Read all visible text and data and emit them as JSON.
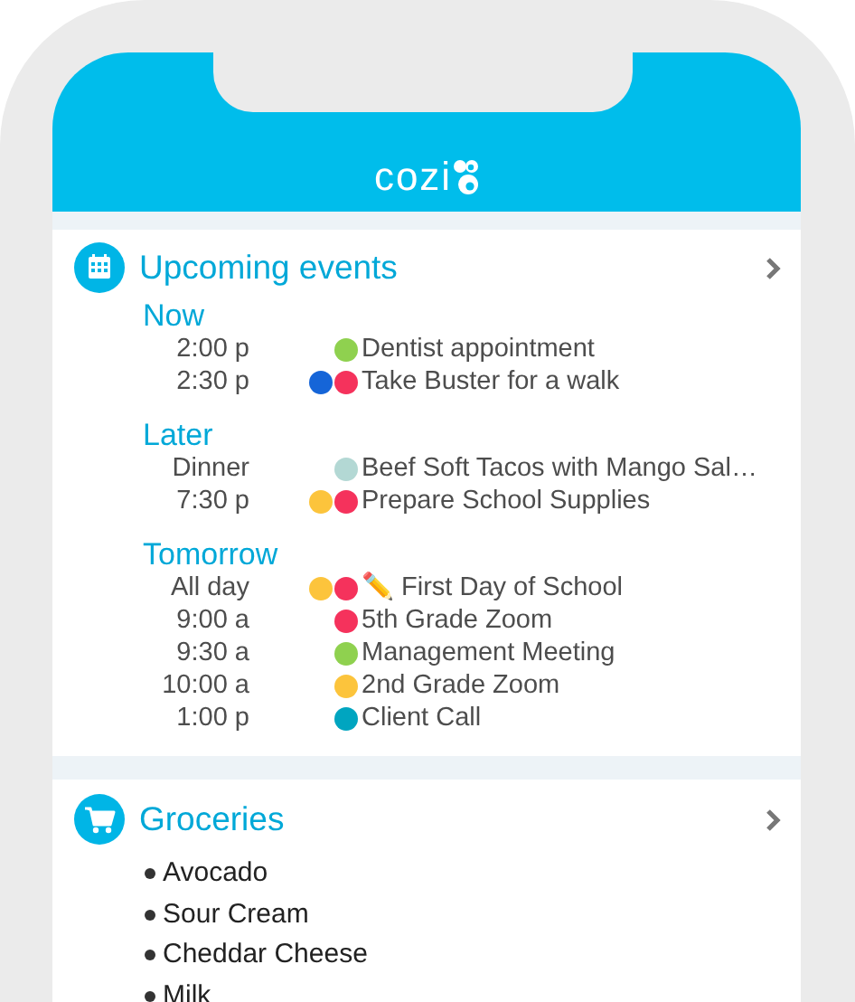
{
  "header": {
    "logo": "cozi"
  },
  "upcoming_events": {
    "title": "Upcoming events",
    "groups": [
      {
        "label": "Now",
        "items": [
          {
            "time": "2:00 p",
            "dots": [
              {
                "color": "#8fd14f"
              }
            ],
            "title": "Dentist appointment"
          },
          {
            "time": "2:30 p",
            "dots": [
              {
                "color": "#1565d8"
              },
              {
                "color": "#f5325c"
              }
            ],
            "title": "Take Buster for a walk"
          }
        ]
      },
      {
        "label": "Later",
        "items": [
          {
            "time": "Dinner",
            "dots": [
              {
                "color": "#b3d8d4"
              }
            ],
            "title": "Beef Soft Tacos with Mango Sal…"
          },
          {
            "time": "7:30 p",
            "dots": [
              {
                "color": "#fcc43c"
              },
              {
                "color": "#f5325c"
              }
            ],
            "title": "Prepare School Supplies"
          }
        ]
      },
      {
        "label": "Tomorrow",
        "items": [
          {
            "time": "All day",
            "dots": [
              {
                "color": "#fcc43c"
              },
              {
                "color": "#f5325c"
              }
            ],
            "title": "✏️ First Day of School"
          },
          {
            "time": "9:00 a",
            "dots": [
              {
                "color": "#f5325c"
              }
            ],
            "title": "5th Grade Zoom"
          },
          {
            "time": "9:30 a",
            "dots": [
              {
                "color": "#8fd14f"
              }
            ],
            "title": "Management Meeting"
          },
          {
            "time": "10:00 a",
            "dots": [
              {
                "color": "#fcc43c"
              }
            ],
            "title": "2nd Grade Zoom"
          },
          {
            "time": "1:00 p",
            "dots": [
              {
                "color": "#00a5c0"
              }
            ],
            "title": "Client Call"
          }
        ]
      }
    ]
  },
  "groceries": {
    "title": "Groceries",
    "items": [
      "Avocado",
      "Sour Cream",
      "Cheddar Cheese",
      "Milk"
    ]
  }
}
